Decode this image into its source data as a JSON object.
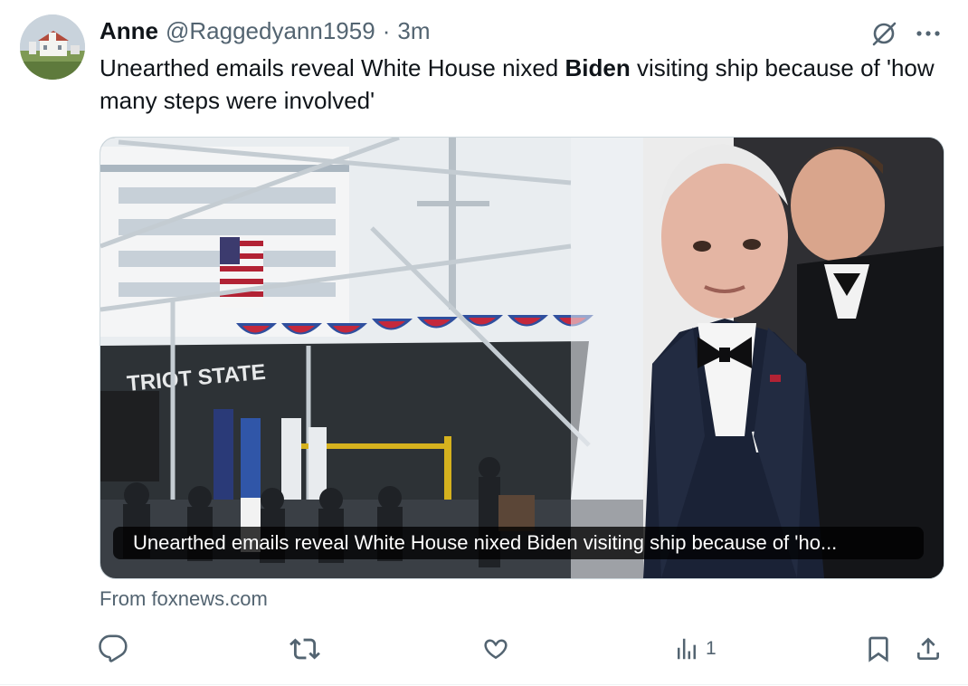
{
  "tweet": {
    "display_name": "Anne",
    "handle": "@Raggedyann1959",
    "separator": "·",
    "time": "3m",
    "text_before": "Unearthed emails reveal White House nixed ",
    "text_bold": "Biden",
    "text_after": " visiting ship because of 'how many steps were involved'"
  },
  "card": {
    "caption": "Unearthed emails reveal White House nixed Biden visiting ship because of 'ho...",
    "source": "From foxnews.com",
    "photo_ship_lettering": "TRIOT STATE"
  },
  "actions": {
    "reply_count": "",
    "repost_count": "",
    "like_count": "",
    "views_count": "1"
  },
  "icons": {
    "avatar": "avatar-farmhouse",
    "grok": "grok-icon",
    "more": "more-dots-icon",
    "reply": "reply-icon",
    "repost": "repost-icon",
    "like": "heart-icon",
    "views": "analytics-icon",
    "bookmark": "bookmark-icon",
    "share": "share-icon"
  },
  "colors": {
    "text_primary": "#0f1419",
    "text_secondary": "#536471",
    "border": "#cfd9de"
  }
}
